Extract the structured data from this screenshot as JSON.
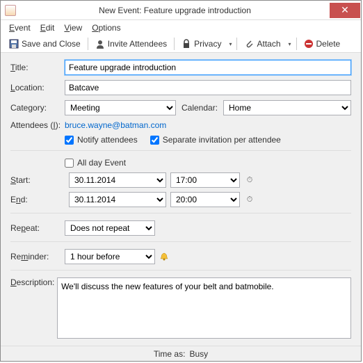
{
  "window": {
    "title": "New Event: Feature upgrade introduction"
  },
  "menu": {
    "event": "Event",
    "edit": "Edit",
    "view": "View",
    "options": "Options"
  },
  "toolbar": {
    "save": "Save and Close",
    "invite": "Invite Attendees",
    "privacy": "Privacy",
    "attach": "Attach",
    "delete": "Delete"
  },
  "labels": {
    "title": "Title:",
    "location": "Location:",
    "category": "Category:",
    "calendar": "Calendar:",
    "attendees": "Attendees (I):",
    "notify": "Notify attendees",
    "separate": "Separate invitation per attendee",
    "allday": "All day Event",
    "start": "Start:",
    "end": "End:",
    "repeat": "Repeat:",
    "reminder": "Reminder:",
    "description": "Description:"
  },
  "fields": {
    "title": "Feature upgrade introduction",
    "location": "Batcave",
    "category": "Meeting",
    "calendar": "Home",
    "attendees": "bruce.wayne@batman.com",
    "notify": true,
    "separate": true,
    "allday": false,
    "start_date": "30.11.2014",
    "start_time": "17:00",
    "end_date": "30.11.2014",
    "end_time": "20:00",
    "repeat": "Does not repeat",
    "reminder": "1 hour before",
    "description": "We'll discuss the new features of your belt and batmobile."
  },
  "status": {
    "timeas_label": "Time as:",
    "timeas_value": "Busy"
  }
}
